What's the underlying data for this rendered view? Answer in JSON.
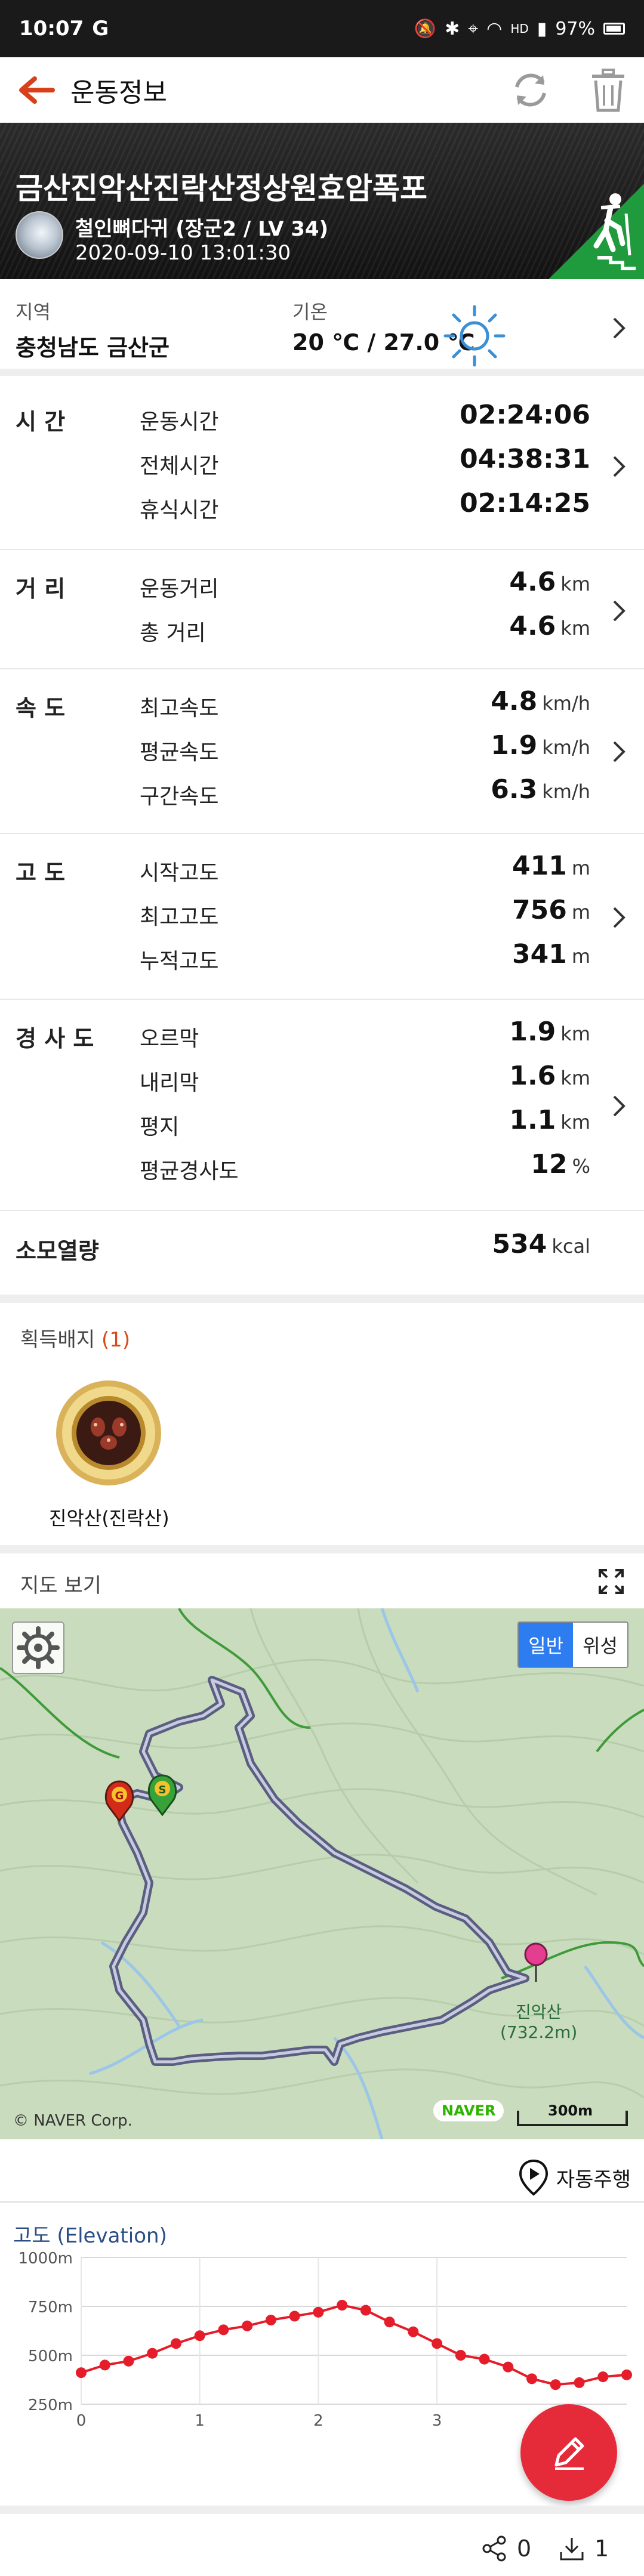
{
  "status_bar": {
    "time": "10:07",
    "g_icon": "G",
    "net": "HD",
    "battery": "97%"
  },
  "appbar": {
    "title": "운동정보"
  },
  "hero": {
    "course_name": "금산진악산진락산정상원효암폭포",
    "user": "철인뼈다귀 (장군2 / LV 34)",
    "datetime": "2020-09-10 13:01:30"
  },
  "region": {
    "label": "지역",
    "value": "충청남도 금산군",
    "temp_label": "기온",
    "temp_value": "20 ℃ / 27.0 ℃"
  },
  "stats": {
    "time": {
      "category": "시   간",
      "rows": [
        {
          "name": "운동시간",
          "value": "02:24:06",
          "unit": ""
        },
        {
          "name": "전체시간",
          "value": "04:38:31",
          "unit": ""
        },
        {
          "name": "휴식시간",
          "value": "02:14:25",
          "unit": ""
        }
      ]
    },
    "distance": {
      "category": "거   리",
      "rows": [
        {
          "name": "운동거리",
          "value": "4.6",
          "unit": "km"
        },
        {
          "name": "총 거리",
          "value": "4.6",
          "unit": "km"
        }
      ]
    },
    "speed": {
      "category": "속   도",
      "rows": [
        {
          "name": "최고속도",
          "value": "4.8",
          "unit": "km/h"
        },
        {
          "name": "평균속도",
          "value": "1.9",
          "unit": "km/h"
        },
        {
          "name": "구간속도",
          "value": "6.3",
          "unit": "km/h"
        }
      ]
    },
    "altitude": {
      "category": "고   도",
      "rows": [
        {
          "name": "시작고도",
          "value": "411",
          "unit": "m"
        },
        {
          "name": "최고고도",
          "value": "756",
          "unit": "m"
        },
        {
          "name": "누적고도",
          "value": "341",
          "unit": "m"
        }
      ]
    },
    "slope": {
      "category": "경 사 도",
      "rows": [
        {
          "name": "오르막",
          "value": "1.9",
          "unit": "km"
        },
        {
          "name": "내리막",
          "value": "1.6",
          "unit": "km"
        },
        {
          "name": "평지",
          "value": "1.1",
          "unit": "km"
        },
        {
          "name": "평균경사도",
          "value": "12",
          "unit": "%"
        }
      ]
    },
    "calories": {
      "category": "소모열량",
      "value": "534",
      "unit": "kcal"
    }
  },
  "badges": {
    "title": "획득배지",
    "count": "(1)",
    "items": [
      {
        "label": "진악산(진락산)"
      }
    ]
  },
  "map": {
    "title": "지도 보기",
    "toggle": [
      "일반",
      "위성"
    ],
    "selected": "일반",
    "copyright": "© NAVER Corp.",
    "naver": "NAVER",
    "scale": "300m",
    "peak_name": "진악산",
    "peak_elev": "(732.2m)",
    "start_marker": "S",
    "goal_marker": "G",
    "autoplay_label": "자동주행"
  },
  "elevation": {
    "title": "고도 (Elevation)"
  },
  "chart_data": {
    "type": "line",
    "title": "고도 (Elevation)",
    "xlabel": "",
    "ylabel": "",
    "x_ticks": [
      "0",
      "1",
      "2",
      "3"
    ],
    "y_ticks": [
      "1000m",
      "750m",
      "500m",
      "250m"
    ],
    "ylim": [
      250,
      1000
    ],
    "xlim": [
      0,
      4.6
    ],
    "grid": true,
    "color": "#e51d2a",
    "x": [
      0.0,
      0.2,
      0.4,
      0.6,
      0.8,
      1.0,
      1.2,
      1.4,
      1.6,
      1.8,
      2.0,
      2.2,
      2.4,
      2.6,
      2.8,
      3.0,
      3.2,
      3.4,
      3.6,
      3.8,
      4.0,
      4.2,
      4.4,
      4.6
    ],
    "y": [
      411,
      450,
      470,
      510,
      560,
      600,
      630,
      650,
      680,
      700,
      720,
      756,
      730,
      670,
      620,
      560,
      500,
      480,
      440,
      380,
      350,
      360,
      390,
      400
    ]
  },
  "footer": {
    "share_count": "0",
    "download_count": "1"
  }
}
